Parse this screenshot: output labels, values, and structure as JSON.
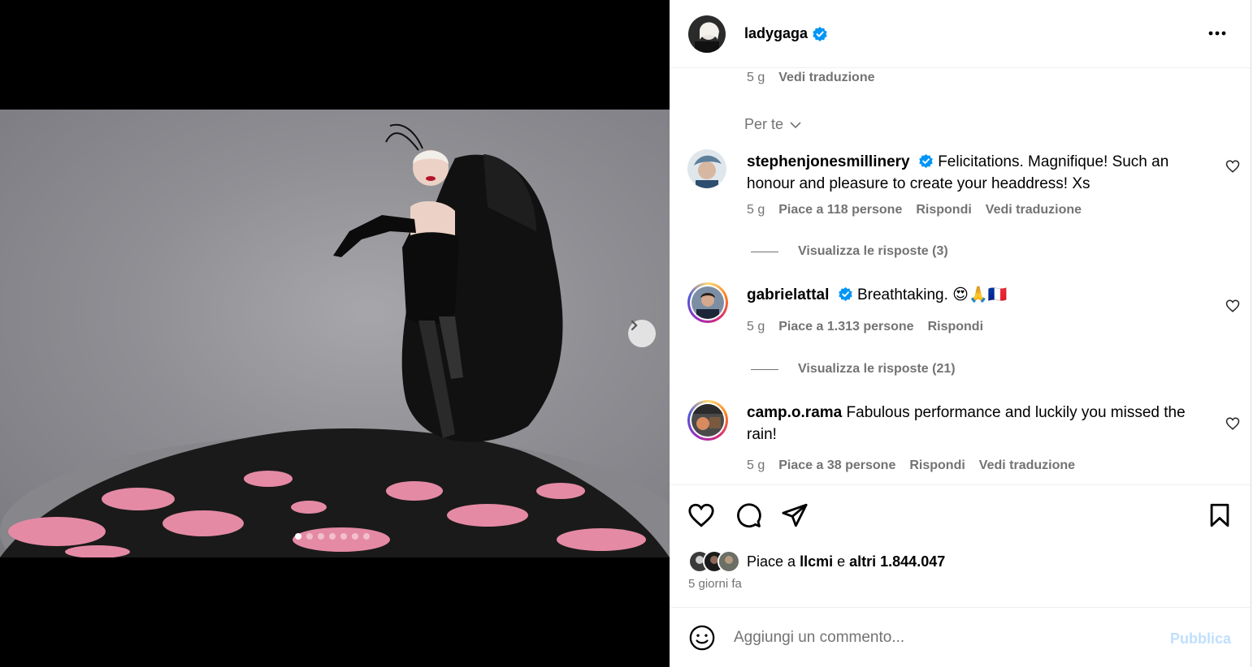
{
  "media": {
    "slide_count": 7,
    "active_slide": 1,
    "next_icon": "chevron-right-icon"
  },
  "post": {
    "author": "ladygaga",
    "verified": true,
    "more_icon": "more-horizontal-icon"
  },
  "caption_meta": {
    "age": "5 g",
    "translate": "Vedi traduzione"
  },
  "filter": {
    "label": "Per te"
  },
  "comments": [
    {
      "user": "stephenjonesmillinery",
      "verified": true,
      "text": "Felicitations. Magnifique! Such an honour and pleasure to create your headdress! Xs",
      "age": "5 g",
      "likes": "Piace a 118 persone",
      "reply": "Rispondi",
      "translate": "Vedi traduzione",
      "view_replies": "Visualizza le risposte (3)"
    },
    {
      "user": "gabrielattal",
      "verified": true,
      "text": "Breathtaking. 😍🙏🇫🇷",
      "age": "5 g",
      "likes": "Piace a 1.313 persone",
      "reply": "Rispondi",
      "view_replies": "Visualizza le risposte (21)"
    },
    {
      "user": "camp.o.rama",
      "verified": false,
      "text": "Fabulous performance and luckily you missed the rain!",
      "age": "5 g",
      "likes": "Piace a 38 persone",
      "reply": "Rispondi",
      "translate": "Vedi traduzione"
    }
  ],
  "actions": {
    "like_icon": "heart-icon",
    "comment_icon": "comment-icon",
    "share_icon": "send-icon",
    "save_icon": "bookmark-icon"
  },
  "likes": {
    "prefix": "Piace a",
    "user": "llcmi",
    "middle": "e",
    "others": "altri 1.844.047"
  },
  "date": "5 giorni fa",
  "composer": {
    "emoji_icon": "smiley-icon",
    "placeholder": "Aggiungi un commento...",
    "publish": "Pubblica"
  },
  "colors": {
    "verified": "#0095f6",
    "muted": "#737373",
    "publish_disabled": "#c0dffd"
  }
}
